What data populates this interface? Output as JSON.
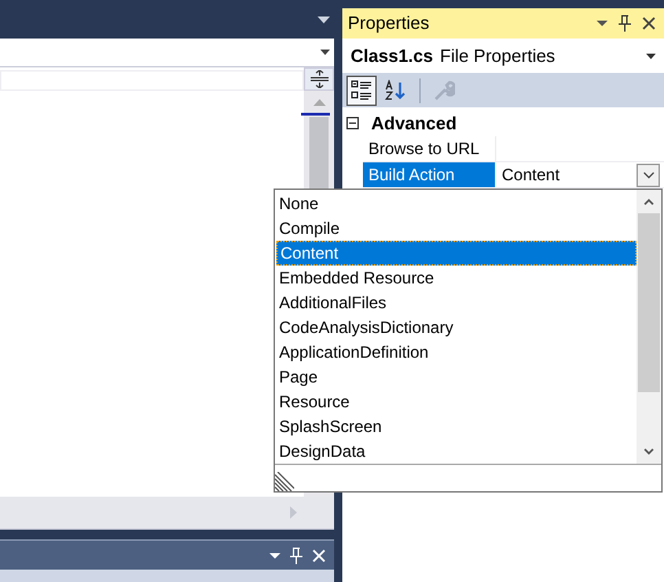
{
  "properties": {
    "title": "Properties",
    "object_name": "Class1.cs",
    "object_type": "File Properties",
    "toolbar": [
      {
        "kind": "categorized",
        "selected": true,
        "disabled": false
      },
      {
        "kind": "alphabetical",
        "selected": false,
        "disabled": false
      },
      {
        "kind": "property-pages",
        "selected": false,
        "disabled": true
      }
    ],
    "categories": [
      {
        "name": "Advanced",
        "expanded": true,
        "properties": [
          {
            "name": "Browse to URL",
            "selected": false
          },
          {
            "name": "Build Action",
            "value": "Content",
            "selected": true
          }
        ]
      }
    ],
    "dropdown": {
      "items": [
        {
          "label": "None",
          "selected": false
        },
        {
          "label": "Compile",
          "selected": false
        },
        {
          "label": "Content",
          "selected": true
        },
        {
          "label": "Embedded Resource",
          "selected": false
        },
        {
          "label": "AdditionalFiles",
          "selected": false
        },
        {
          "label": "CodeAnalysisDictionary",
          "selected": false
        },
        {
          "label": "ApplicationDefinition",
          "selected": false
        },
        {
          "label": "Page",
          "selected": false
        },
        {
          "label": "Resource",
          "selected": false
        },
        {
          "label": "SplashScreen",
          "selected": false
        },
        {
          "label": "DesignData",
          "selected": false
        }
      ]
    }
  }
}
